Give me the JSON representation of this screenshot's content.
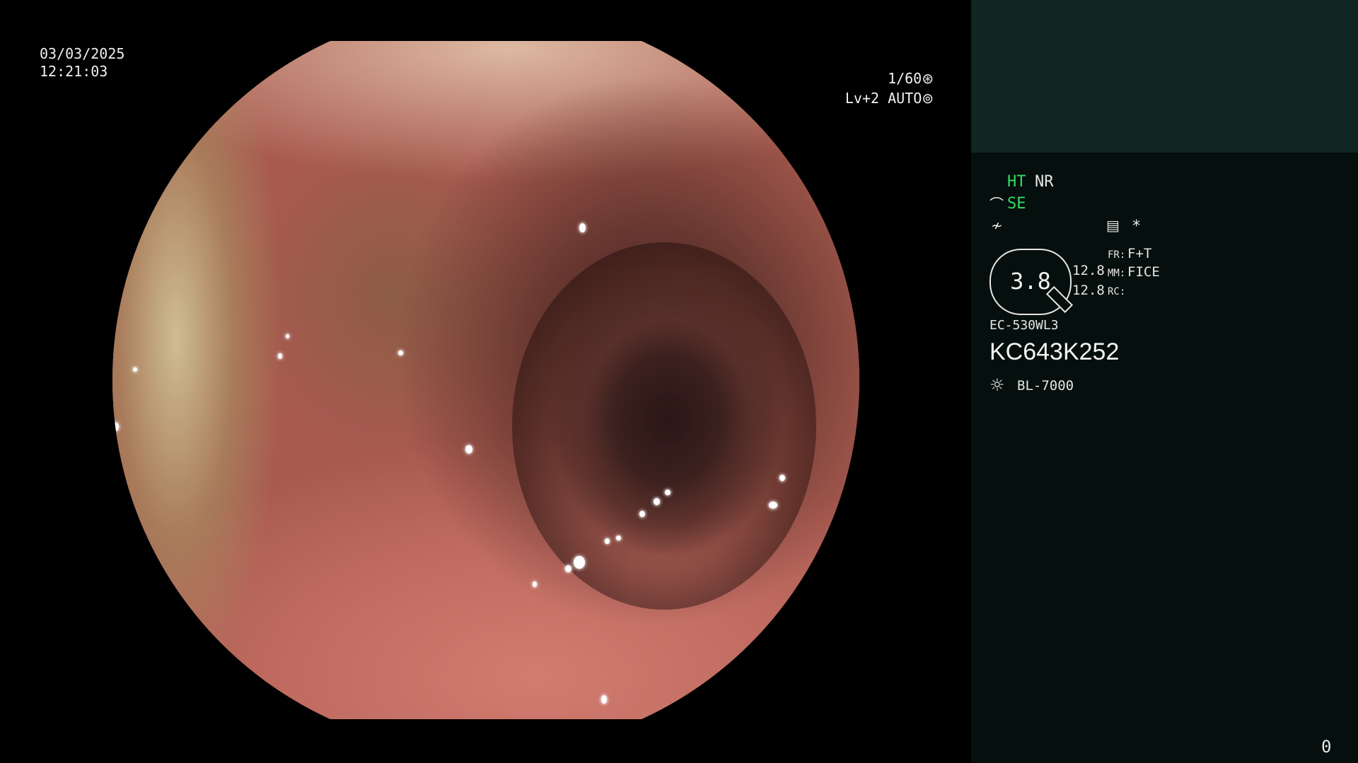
{
  "overlay": {
    "date": "03/03/2025",
    "time": "12:21:03",
    "shutter": "1/60",
    "shutter_icon": "shutter-icon",
    "iris": "Lv+2 AUTO",
    "iris_icon": "iris-icon"
  },
  "panel": {
    "colors": {
      "active": "#33dd66",
      "text": "#e6e6e6",
      "top_band": "#0f2623",
      "background": "#050f0d"
    },
    "ht_label": "HT",
    "nr_label": "NR",
    "se_label": "SE",
    "sensor_icon": "structure-enhance-icon",
    "gamma_icon": "gamma-icon",
    "memo_icon": "memo-icon",
    "asterisk": "*",
    "lever_value": "3.8",
    "value_a": "12.8",
    "value_b": "12.8",
    "fr_label": "FR:",
    "fr_value": "F+T",
    "mm_label": "MM:",
    "mm_value": "FICE",
    "rc_label": "RC:",
    "rc_value": "",
    "scope_model": "EC-530WL3",
    "scope_serial": "KC643K252",
    "light_icon": "light-source-icon",
    "light_source": "BL-7000",
    "counter": "0"
  }
}
